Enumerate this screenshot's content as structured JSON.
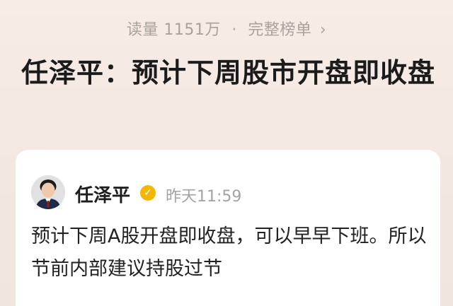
{
  "meta": {
    "views_label": "读量",
    "views_count": "1151万",
    "separator": "·",
    "link_label": "完整榜单",
    "chevron": "›"
  },
  "headline": {
    "text": "任泽平：预计下周股市开盘即收盘"
  },
  "post": {
    "author": "任泽平",
    "verified_mark": "✓",
    "time": "昨天11:59",
    "content": "预计下周A股开盘即收盘，可以早早下班。所以节前内部建议持股过节"
  },
  "colors": {
    "background": "#f3e7e1",
    "card": "#ffffff",
    "verified_badge": "#f2b705",
    "muted_text": "#a9a29d",
    "title_text": "#1b1b1b"
  },
  "icons": {
    "verified": "verified-badge-icon",
    "chevron": "chevron-right-icon",
    "avatar": "user-avatar"
  }
}
